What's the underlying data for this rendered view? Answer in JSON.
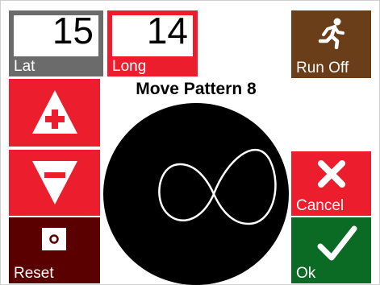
{
  "lat": {
    "value": "15",
    "label": "Lat",
    "color": "#6b6b6b"
  },
  "long": {
    "value": "14",
    "label": "Long",
    "color": "#ec1d2c"
  },
  "run": {
    "label": "Run Off",
    "icon": "running-person-icon",
    "color": "#6b3e1a"
  },
  "pattern": {
    "title": "Move Pattern 8",
    "shape": "figure-eight"
  },
  "increase": {
    "icon": "plus-triangle-up-icon"
  },
  "decrease": {
    "icon": "minus-triangle-down-icon"
  },
  "reset": {
    "label": "Reset",
    "icon": "center-dot-icon",
    "color": "#5a0000"
  },
  "cancel": {
    "label": "Cancel",
    "icon": "x-icon",
    "color": "#ec1d2c"
  },
  "ok": {
    "label": "Ok",
    "icon": "checkmark-icon",
    "color": "#0b6a24"
  }
}
